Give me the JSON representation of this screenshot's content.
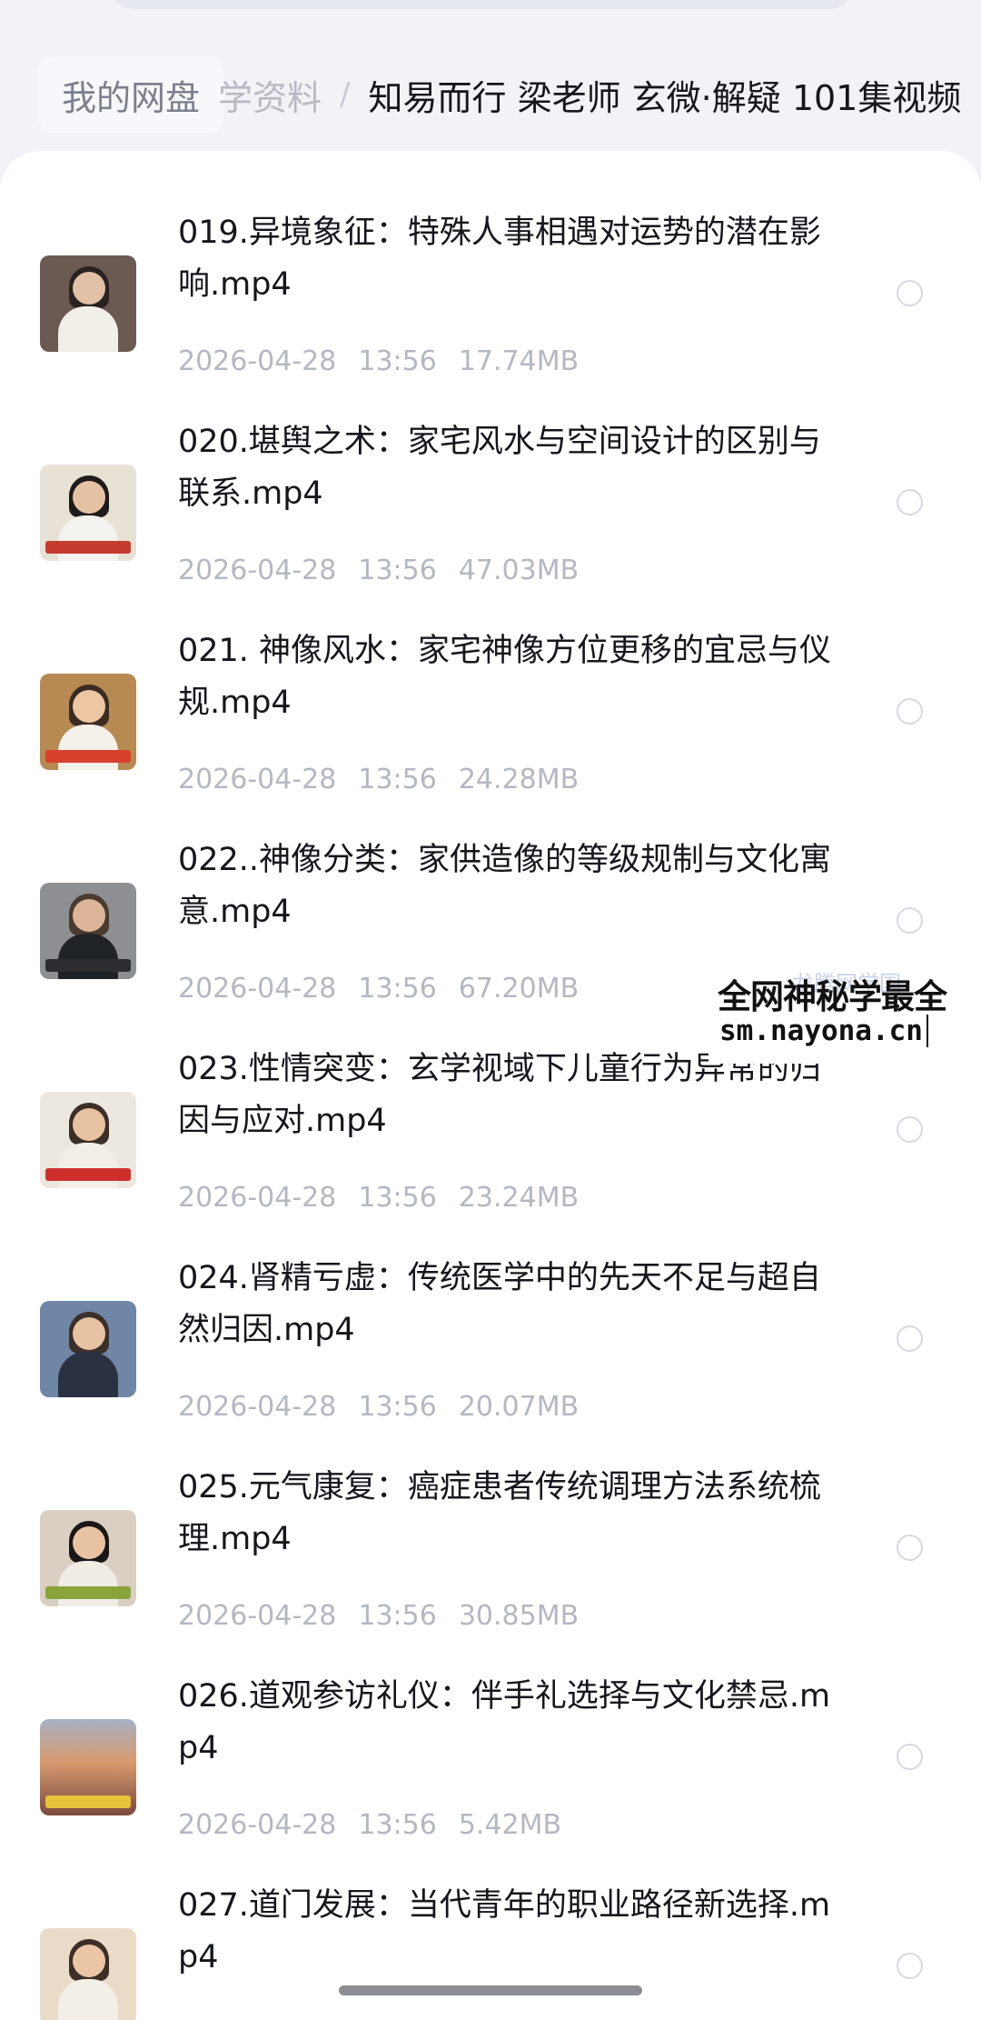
{
  "breadcrumb": {
    "home": "我的网盘",
    "mid": "学资料",
    "separator": "/",
    "current": "知易而行 梁老师 玄微·解疑 101集视频"
  },
  "files": [
    {
      "name": "019.异境象征：特殊人事相遇对运势的潜在影响.mp4",
      "date": "2026-04-28",
      "time": "13:56",
      "size": "17.74MB",
      "thumb": "thumb-meeting"
    },
    {
      "name": "020.堪舆之术：家宅风水与空间设计的区别与联系.mp4",
      "date": "2026-04-28",
      "time": "13:56",
      "size": "47.03MB",
      "thumb": "thumb-speaker-long-hair"
    },
    {
      "name": "021. 神像风水：家宅神像方位更移的宜忌与仪规.mp4",
      "date": "2026-04-28",
      "time": "13:56",
      "size": "24.28MB",
      "thumb": "thumb-speaker-glasses",
      "badge": "相信第一直觉"
    },
    {
      "name": "022..神像分类：家供造像的等级规制与文化寓意.mp4",
      "date": "2026-04-28",
      "time": "13:56",
      "size": "67.20MB",
      "thumb": "thumb-speaker-dark"
    },
    {
      "name": "023.性情突变：玄学视域下儿童行为异常的归因与应对.mp4",
      "date": "2026-04-28",
      "time": "13:56",
      "size": "23.24MB",
      "thumb": "thumb-speaker-red-caption"
    },
    {
      "name": "024.肾精亏虚：传统医学中的先天不足与超自然归因.mp4",
      "date": "2026-04-28",
      "time": "13:56",
      "size": "20.07MB",
      "thumb": "thumb-speaker-desk"
    },
    {
      "name": "025.元气康复：癌症患者传统调理方法系统梳理.mp4",
      "date": "2026-04-28",
      "time": "13:56",
      "size": "30.85MB",
      "thumb": "thumb-speaker-table"
    },
    {
      "name": "026.道观参访礼仪：伴手礼选择与文化禁忌.mp4",
      "date": "2026-04-28",
      "time": "13:56",
      "size": "5.42MB",
      "thumb": "thumb-sunset"
    },
    {
      "name": "027.道门发展：当代青年的职业路径新选择.mp4",
      "date": "2026-04-28",
      "time": "13:56",
      "size": "",
      "thumb": "thumb-speaker-light"
    }
  ],
  "watermark": {
    "line1": "全网神秘学最全",
    "line2": "sm.nayona.cn",
    "faint": "龙腾网学国"
  },
  "colors": {
    "background": "#f2f3f7",
    "panel": "#ffffff",
    "text_primary": "#15171c",
    "text_secondary": "#b4b8c1"
  }
}
